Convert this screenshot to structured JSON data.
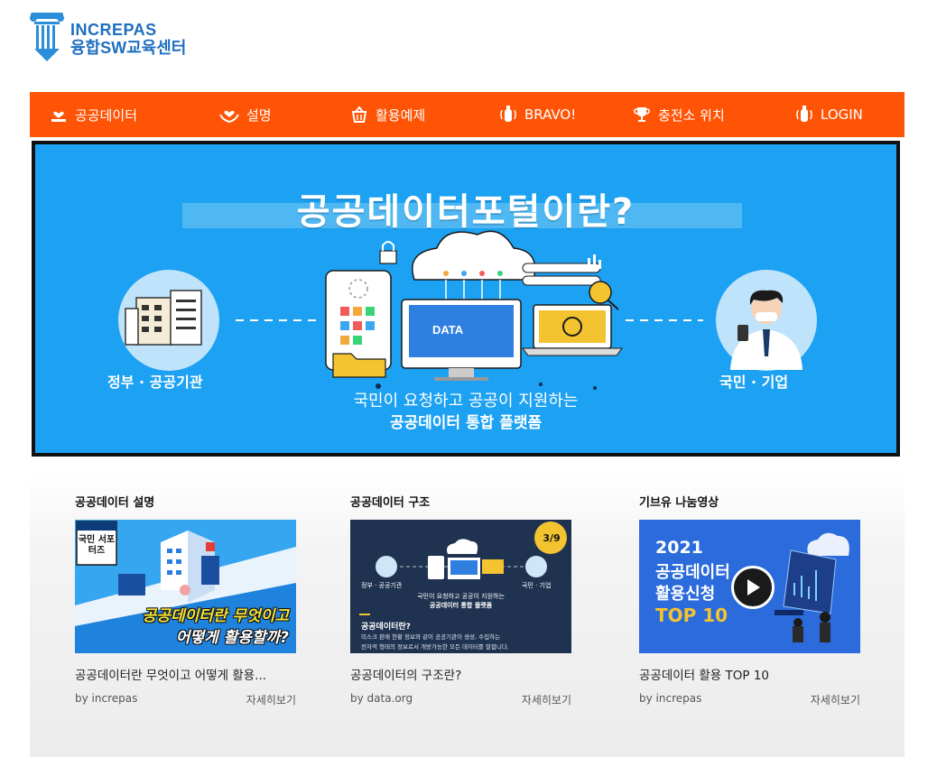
{
  "logo": {
    "line1": "INCREPAS",
    "line2": "융합SW교육센터"
  },
  "nav": [
    {
      "label": "공공데이터",
      "icon": "hand-heart-icon"
    },
    {
      "label": "설명",
      "icon": "heart-hands-icon"
    },
    {
      "label": "활용예제",
      "icon": "basket-icon"
    },
    {
      "label": "BRAVO!",
      "icon": "hand-wave-icon"
    },
    {
      "label": "충전소 위치",
      "icon": "trophy-icon"
    },
    {
      "label": "LOGIN",
      "icon": "hand-wave-icon"
    }
  ],
  "hero": {
    "title": "공공데이터포털이란?",
    "left_label": "정부 · 공공기관",
    "right_label": "국민 · 기업",
    "caption_line1": "국민이 요청하고 공공이 지원하는",
    "caption_line2": "공공데이터 통합 플랫폼",
    "monitor_text": "DATA"
  },
  "cards": [
    {
      "heading": "공공데이터 설명",
      "thumb_text1": "공공데이터란 무엇이고",
      "thumb_text2": "어떻게 활용할까?",
      "thumb_badge": "국민 서포터즈",
      "title": "공공데이터란 무엇이고 어떻게 활용...",
      "author": "by increpas",
      "more": "자세히보기"
    },
    {
      "heading": "공공데이터 구조",
      "thumb_page": "3/9",
      "thumb_q": "공공데이터란?",
      "thumb_desc1": "미스크 판매 현황 정보와 같이 공공기관이 생성, 수집하는",
      "thumb_desc2": "전자적 형태의 정보로서 개방가능한 모든 데이터를 말합니다.",
      "title": "공공데이터의 구조란?",
      "author": "by data.org",
      "more": "자세히보기"
    },
    {
      "heading": "기브유 나눔영상",
      "thumb_year": "2021",
      "thumb_line1": "공공데이터",
      "thumb_line2": "활용신청",
      "thumb_line3": "TOP 10",
      "title": "공공데이터 활용 TOP 10",
      "author": "by increpas",
      "more": "자세히보기"
    }
  ],
  "colors": {
    "nav_bg": "#ff5406",
    "hero_bg": "#1da1f2",
    "brand": "#1f6fc0"
  }
}
